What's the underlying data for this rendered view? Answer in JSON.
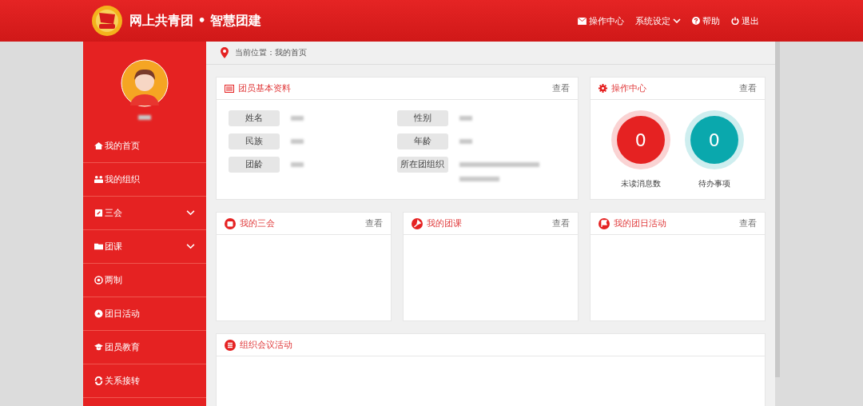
{
  "header": {
    "title": "网上共青团 • 智慧团建",
    "nav": [
      {
        "label": "操作中心"
      },
      {
        "label": "系统设定"
      },
      {
        "label": "帮助"
      },
      {
        "label": "退出"
      }
    ]
  },
  "sidebar": {
    "items": [
      {
        "label": "我的首页",
        "kind": "link"
      },
      {
        "label": "我的组织",
        "kind": "link"
      },
      {
        "label": "三会",
        "kind": "group"
      },
      {
        "label": "团课",
        "kind": "group"
      },
      {
        "label": "两制",
        "kind": "link"
      },
      {
        "label": "团日活动",
        "kind": "link"
      },
      {
        "label": "团员教育",
        "kind": "link"
      },
      {
        "label": "关系接转",
        "kind": "link"
      }
    ]
  },
  "breadcrumb": "当前位置：我的首页",
  "profile": {
    "title": "团员基本资料",
    "link": "查看",
    "fields": [
      {
        "label": "姓名"
      },
      {
        "label": "性别"
      },
      {
        "label": "民族"
      },
      {
        "label": "年龄"
      },
      {
        "label": "团龄"
      },
      {
        "label": "所在团组织"
      }
    ]
  },
  "operations": {
    "title": "操作中心",
    "link": "查看",
    "counters": [
      {
        "value": "0",
        "label": "未读消息数",
        "color": "#e52222"
      },
      {
        "value": "0",
        "label": "待办事项",
        "color": "#0aa8ad"
      }
    ]
  },
  "panels": [
    {
      "title": "我的三会",
      "link": "查看"
    },
    {
      "title": "我的团课",
      "link": "查看"
    },
    {
      "title": "我的团日活动",
      "link": "查看"
    }
  ],
  "meetings": {
    "title": "组织会议活动"
  }
}
